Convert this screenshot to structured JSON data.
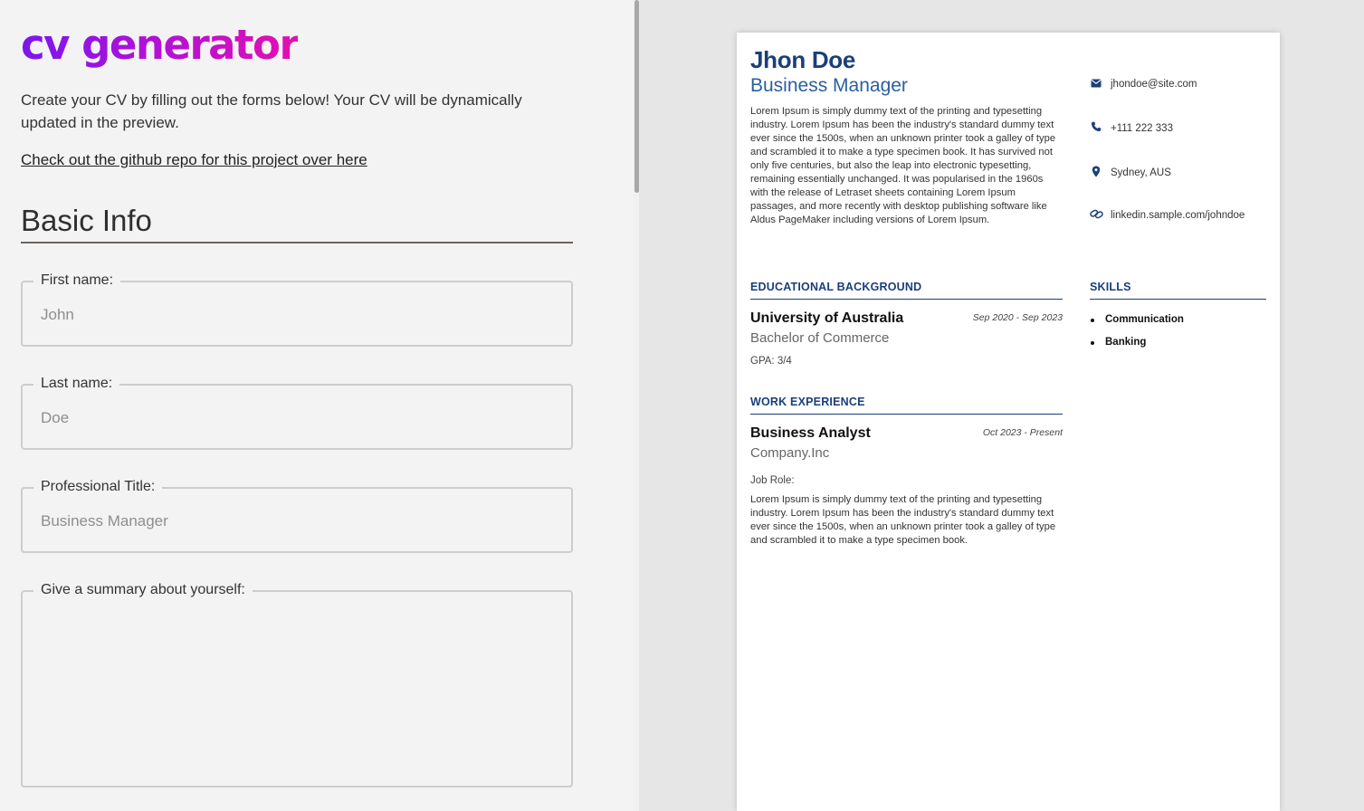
{
  "editor": {
    "logo": "cv generator",
    "intro": "Create your CV by filling out the forms below! Your CV will be dynamically updated in the preview.",
    "repo_link": "Check out the github repo for this project over here",
    "section_title": "Basic Info",
    "fields": {
      "first_name": {
        "label": "First name:",
        "placeholder": "John",
        "value": ""
      },
      "last_name": {
        "label": "Last name:",
        "placeholder": "Doe",
        "value": ""
      },
      "professional_title": {
        "label": "Professional Title:",
        "placeholder": "Business Manager",
        "value": ""
      },
      "summary": {
        "label": "Give a summary about yourself:",
        "placeholder": "",
        "value": ""
      }
    }
  },
  "cv": {
    "name": "Jhon Doe",
    "title": "Business Manager",
    "summary": "Lorem Ipsum is simply dummy text of the printing and typesetting industry. Lorem Ipsum has been the industry's standard dummy text ever since the 1500s, when an unknown printer took a galley of type and scrambled it to make a type specimen book. It has survived not only five centuries, but also the leap into electronic typesetting, remaining essentially unchanged. It was popularised in the 1960s with the release of Letraset sheets containing Lorem Ipsum passages, and more recently with desktop publishing software like Aldus PageMaker including versions of Lorem Ipsum.",
    "contact": {
      "email": "jhondoe@site.com",
      "phone": "+111 222 333",
      "location": "Sydney, AUS",
      "linkedin": "linkedin.sample.com/johndoe"
    },
    "education_heading": "EDUCATIONAL BACKGROUND",
    "education": {
      "school": "University of Australia",
      "degree": "Bachelor of Commerce",
      "dates": "Sep 2020 - Sep 2023",
      "gpa": "GPA: 3/4"
    },
    "work_heading": "WORK EXPERIENCE",
    "work": {
      "position": "Business Analyst",
      "company": "Company.Inc",
      "dates": "Oct 2023 - Present",
      "role_label": "Job Role:",
      "description": "Lorem Ipsum is simply dummy text of the printing and typesetting industry. Lorem Ipsum has been the industry's standard dummy text ever since the 1500s, when an unknown printer took a galley of type and scrambled it to make a type specimen book."
    },
    "skills_heading": "SKILLS",
    "skills": [
      "Communication",
      "Banking"
    ]
  },
  "icons": {
    "email": "envelope-icon",
    "phone": "phone-icon",
    "location": "map-pin-icon",
    "linkedin": "link-icon"
  },
  "colors": {
    "accent": "#1a3f7a",
    "logo_gradient_start": "#7b16ee",
    "logo_gradient_end": "#e30fb0"
  }
}
